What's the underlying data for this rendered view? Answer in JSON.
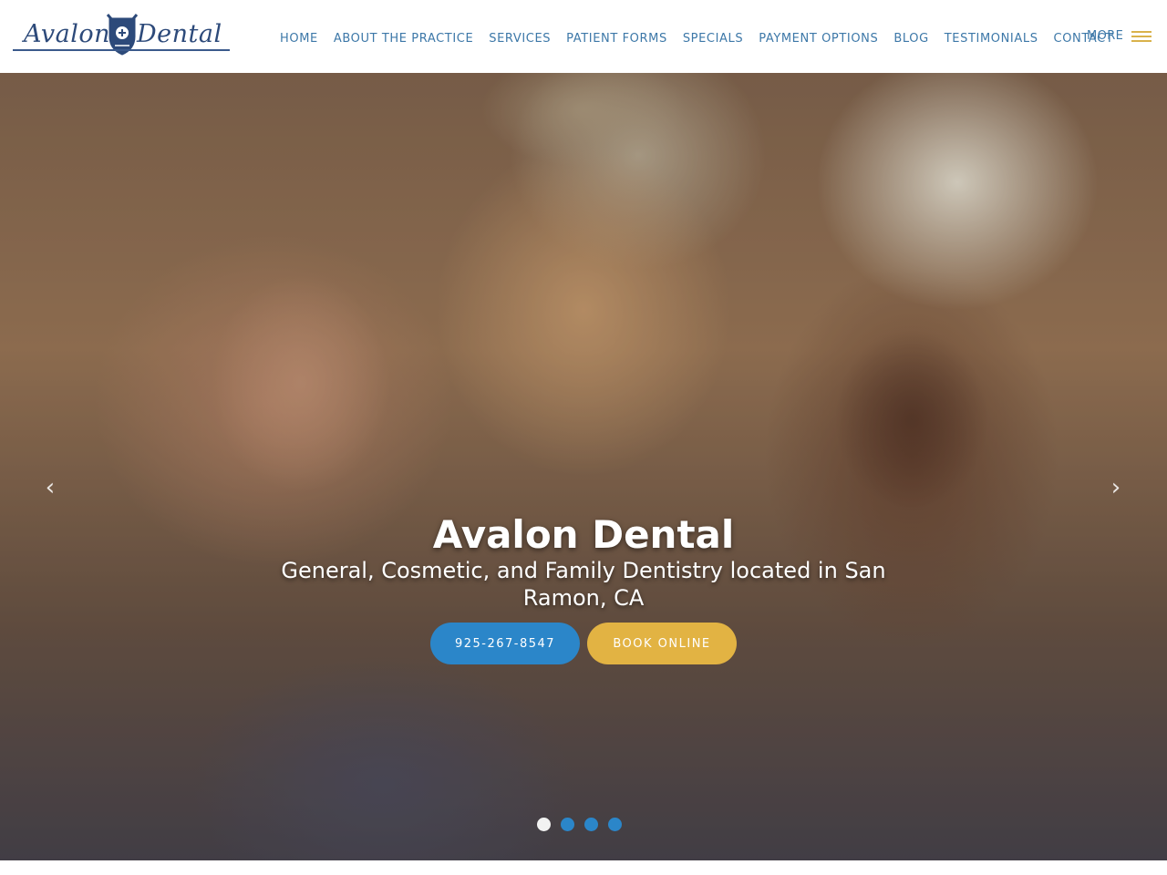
{
  "brand": {
    "logo_left": "Avalon",
    "logo_right": "Dental",
    "logo_icon": "crest-icon"
  },
  "nav": {
    "items": [
      {
        "label": "HOME"
      },
      {
        "label": "ABOUT THE PRACTICE"
      },
      {
        "label": "SERVICES"
      },
      {
        "label": "PATIENT FORMS"
      },
      {
        "label": "SPECIALS"
      },
      {
        "label": "PAYMENT OPTIONS"
      },
      {
        "label": "BLOG"
      },
      {
        "label": "TESTIMONIALS"
      },
      {
        "label": "CONTACT"
      }
    ],
    "more_label": "MORE",
    "menu_icon": "hamburger-icon"
  },
  "hero": {
    "title": "Avalon Dental",
    "subtitle": "General, Cosmetic, and Family Dentistry located in San Ramon, CA",
    "phone_button": "925-267-8547",
    "book_button": "BOOK ONLINE",
    "prev_icon": "chevron-left-icon",
    "next_icon": "chevron-right-icon",
    "slides": {
      "count": 4,
      "active_index": 0
    }
  },
  "colors": {
    "nav_text": "#3d78a8",
    "accent_blue": "#2b86c9",
    "accent_gold": "#e2b343",
    "logo_navy": "#2d4a7a"
  }
}
